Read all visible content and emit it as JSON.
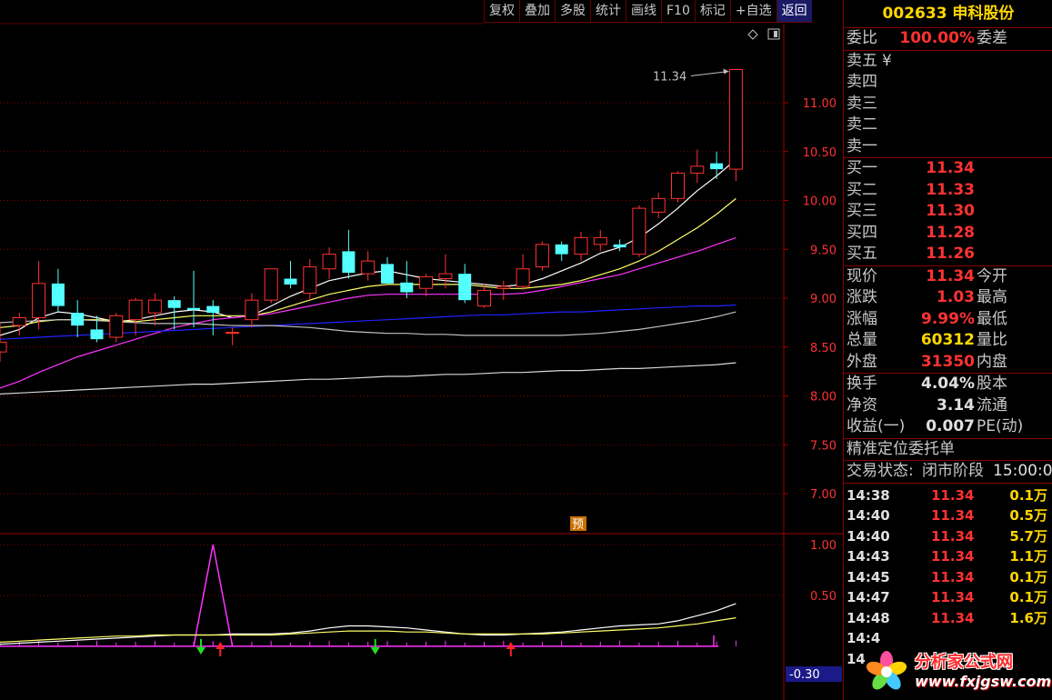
{
  "toolbar": {
    "items": [
      "复权",
      "叠加",
      "多股",
      "统计",
      "画线",
      "F10",
      "标记",
      "+自选",
      "返回"
    ]
  },
  "chart_data": {
    "type": "candlestick",
    "title": "",
    "main_axis": {
      "ylim": [
        6.6,
        11.8
      ],
      "ticks": [
        "11.00",
        "10.50",
        "10.00",
        "9.50",
        "9.00",
        "8.50",
        "8.00",
        "7.50",
        "7.00"
      ]
    },
    "high_annotation": "11.34",
    "candles": [
      {
        "o": 8.45,
        "h": 8.75,
        "l": 8.35,
        "c": 8.55
      },
      {
        "o": 8.72,
        "h": 8.85,
        "l": 8.62,
        "c": 8.8
      },
      {
        "o": 8.8,
        "h": 9.38,
        "l": 8.68,
        "c": 9.15
      },
      {
        "o": 9.15,
        "h": 9.3,
        "l": 8.85,
        "c": 8.92
      },
      {
        "o": 8.85,
        "h": 8.98,
        "l": 8.6,
        "c": 8.72
      },
      {
        "o": 8.68,
        "h": 8.82,
        "l": 8.55,
        "c": 8.58
      },
      {
        "o": 8.6,
        "h": 8.85,
        "l": 8.55,
        "c": 8.82
      },
      {
        "o": 8.78,
        "h": 9.0,
        "l": 8.62,
        "c": 8.98
      },
      {
        "o": 8.85,
        "h": 9.05,
        "l": 8.72,
        "c": 8.98
      },
      {
        "o": 8.98,
        "h": 9.02,
        "l": 8.68,
        "c": 8.9
      },
      {
        "o": 8.9,
        "h": 9.28,
        "l": 8.7,
        "c": 8.88
      },
      {
        "o": 8.92,
        "h": 8.98,
        "l": 8.62,
        "c": 8.85
      },
      {
        "o": 8.65,
        "h": 8.7,
        "l": 8.52,
        "c": 8.65
      },
      {
        "o": 8.78,
        "h": 9.05,
        "l": 8.7,
        "c": 8.98
      },
      {
        "o": 8.98,
        "h": 9.2,
        "l": 8.95,
        "c": 9.3
      },
      {
        "o": 9.2,
        "h": 9.38,
        "l": 9.1,
        "c": 9.14
      },
      {
        "o": 9.05,
        "h": 9.4,
        "l": 8.98,
        "c": 9.32
      },
      {
        "o": 9.3,
        "h": 9.52,
        "l": 9.2,
        "c": 9.45
      },
      {
        "o": 9.48,
        "h": 9.7,
        "l": 9.2,
        "c": 9.26
      },
      {
        "o": 9.25,
        "h": 9.48,
        "l": 9.18,
        "c": 9.38
      },
      {
        "o": 9.35,
        "h": 9.42,
        "l": 9.15,
        "c": 9.15
      },
      {
        "o": 9.16,
        "h": 9.38,
        "l": 9.0,
        "c": 9.06
      },
      {
        "o": 9.1,
        "h": 9.25,
        "l": 9.02,
        "c": 9.22
      },
      {
        "o": 9.2,
        "h": 9.45,
        "l": 9.1,
        "c": 9.25
      },
      {
        "o": 9.25,
        "h": 9.35,
        "l": 8.95,
        "c": 8.98
      },
      {
        "o": 8.92,
        "h": 9.15,
        "l": 8.9,
        "c": 9.08
      },
      {
        "o": 9.1,
        "h": 9.18,
        "l": 8.98,
        "c": 9.12
      },
      {
        "o": 9.12,
        "h": 9.45,
        "l": 9.08,
        "c": 9.3
      },
      {
        "o": 9.32,
        "h": 9.58,
        "l": 9.28,
        "c": 9.55
      },
      {
        "o": 9.55,
        "h": 9.58,
        "l": 9.38,
        "c": 9.45
      },
      {
        "o": 9.45,
        "h": 9.68,
        "l": 9.38,
        "c": 9.62
      },
      {
        "o": 9.55,
        "h": 9.7,
        "l": 9.48,
        "c": 9.62
      },
      {
        "o": 9.55,
        "h": 9.6,
        "l": 9.48,
        "c": 9.52
      },
      {
        "o": 9.45,
        "h": 9.95,
        "l": 9.42,
        "c": 9.92
      },
      {
        "o": 9.88,
        "h": 10.08,
        "l": 9.82,
        "c": 10.02
      },
      {
        "o": 10.02,
        "h": 10.3,
        "l": 9.98,
        "c": 10.28
      },
      {
        "o": 10.28,
        "h": 10.52,
        "l": 10.18,
        "c": 10.35
      },
      {
        "o": 10.38,
        "h": 10.5,
        "l": 10.22,
        "c": 10.32
      },
      {
        "o": 10.32,
        "h": 11.34,
        "l": 10.2,
        "c": 11.34
      }
    ],
    "ma_lines": [
      {
        "color": "#ffffff",
        "values": [
          8.62,
          8.68,
          8.8,
          8.86,
          8.84,
          8.8,
          8.76,
          8.78,
          8.82,
          8.86,
          8.88,
          8.86,
          8.8,
          8.82,
          8.92,
          9.02,
          9.1,
          9.18,
          9.22,
          9.26,
          9.28,
          9.24,
          9.2,
          9.18,
          9.16,
          9.14,
          9.12,
          9.14,
          9.2,
          9.28,
          9.36,
          9.46,
          9.52,
          9.62,
          9.76,
          9.92,
          10.1,
          10.25,
          10.42
        ]
      },
      {
        "color": "#ffff66",
        "values": [
          8.7,
          8.72,
          8.76,
          8.78,
          8.78,
          8.78,
          8.77,
          8.76,
          8.78,
          8.8,
          8.82,
          8.82,
          8.82,
          8.82,
          8.86,
          8.92,
          8.98,
          9.04,
          9.08,
          9.12,
          9.14,
          9.14,
          9.14,
          9.14,
          9.14,
          9.12,
          9.1,
          9.1,
          9.12,
          9.14,
          9.18,
          9.24,
          9.3,
          9.38,
          9.48,
          9.6,
          9.72,
          9.86,
          10.02
        ]
      },
      {
        "color": "#ff33ff",
        "values": [
          8.08,
          8.15,
          8.24,
          8.32,
          8.4,
          8.46,
          8.52,
          8.58,
          8.64,
          8.7,
          8.74,
          8.78,
          8.8,
          8.82,
          8.84,
          8.88,
          8.92,
          8.96,
          9.0,
          9.03,
          9.04,
          9.04,
          9.04,
          9.04,
          9.04,
          9.04,
          9.04,
          9.05,
          9.08,
          9.12,
          9.16,
          9.2,
          9.24,
          9.3,
          9.36,
          9.42,
          9.48,
          9.55,
          9.62
        ]
      },
      {
        "color": "#2222ff",
        "values": [
          8.58,
          8.59,
          8.6,
          8.61,
          8.62,
          8.63,
          8.64,
          8.65,
          8.66,
          8.67,
          8.68,
          8.69,
          8.7,
          8.71,
          8.72,
          8.73,
          8.74,
          8.75,
          8.76,
          8.77,
          8.78,
          8.79,
          8.8,
          8.81,
          8.82,
          8.83,
          8.83,
          8.84,
          8.85,
          8.86,
          8.86,
          8.87,
          8.88,
          8.89,
          8.9,
          8.91,
          8.92,
          8.92,
          8.93
        ]
      },
      {
        "color": "#c0c0c0",
        "values": [
          8.75,
          8.76,
          8.77,
          8.78,
          8.78,
          8.77,
          8.76,
          8.75,
          8.74,
          8.74,
          8.74,
          8.73,
          8.72,
          8.72,
          8.72,
          8.71,
          8.7,
          8.68,
          8.66,
          8.65,
          8.64,
          8.64,
          8.63,
          8.63,
          8.62,
          8.62,
          8.62,
          8.62,
          8.62,
          8.62,
          8.63,
          8.64,
          8.66,
          8.68,
          8.71,
          8.74,
          8.77,
          8.81,
          8.86
        ]
      },
      {
        "color": "#d8d8d8",
        "values": [
          8.02,
          8.03,
          8.04,
          8.05,
          8.06,
          8.07,
          8.08,
          8.09,
          8.1,
          8.11,
          8.12,
          8.12,
          8.13,
          8.14,
          8.15,
          8.16,
          8.17,
          8.17,
          8.18,
          8.19,
          8.2,
          8.2,
          8.21,
          8.22,
          8.22,
          8.23,
          8.24,
          8.24,
          8.25,
          8.26,
          8.26,
          8.27,
          8.28,
          8.28,
          8.29,
          8.3,
          8.31,
          8.32,
          8.34
        ]
      }
    ],
    "badge": "预",
    "sub_axis": {
      "ylim": [
        -0.1,
        1.1
      ],
      "ticks": [
        "1.00",
        "0.50"
      ],
      "current": "-0.30"
    },
    "sub_white": [
      0.02,
      0.03,
      0.04,
      0.05,
      0.06,
      0.07,
      0.08,
      0.09,
      0.1,
      0.11,
      0.11,
      0.11,
      0.12,
      0.12,
      0.12,
      0.13,
      0.15,
      0.18,
      0.2,
      0.2,
      0.19,
      0.18,
      0.16,
      0.14,
      0.12,
      0.11,
      0.11,
      0.12,
      0.13,
      0.14,
      0.16,
      0.18,
      0.2,
      0.21,
      0.22,
      0.25,
      0.3,
      0.35,
      0.42
    ],
    "sub_yellow": [
      0.04,
      0.05,
      0.06,
      0.07,
      0.08,
      0.09,
      0.1,
      0.1,
      0.11,
      0.11,
      0.11,
      0.11,
      0.11,
      0.11,
      0.11,
      0.12,
      0.13,
      0.14,
      0.15,
      0.15,
      0.15,
      0.14,
      0.14,
      0.13,
      0.12,
      0.12,
      0.12,
      0.12,
      0.12,
      0.13,
      0.14,
      0.15,
      0.16,
      0.17,
      0.18,
      0.2,
      0.22,
      0.25,
      0.28
    ],
    "sub_spike_index": 11,
    "down_arrows": [
      10,
      19
    ],
    "up_arrows": [
      11,
      26
    ]
  },
  "panel": {
    "header": "002633 申科股份",
    "webi": {
      "label": "委比",
      "value": "100.00%",
      "label2": "委差"
    },
    "asks": [
      "卖五",
      "卖四",
      "卖三",
      "卖二",
      "卖一"
    ],
    "ask_tail": "¥",
    "bids": [
      {
        "label": "买一",
        "value": "11.34"
      },
      {
        "label": "买二",
        "value": "11.33"
      },
      {
        "label": "买三",
        "value": "11.30"
      },
      {
        "label": "买四",
        "value": "11.28"
      },
      {
        "label": "买五",
        "value": "11.26"
      }
    ],
    "quote": [
      {
        "label": "现价",
        "value": "11.34",
        "cls": "red",
        "label2": "今开"
      },
      {
        "label": "涨跌",
        "value": "1.03",
        "cls": "red",
        "label2": "最高"
      },
      {
        "label": "涨幅",
        "value": "9.99%",
        "cls": "red",
        "label2": "最低"
      },
      {
        "label": "总量",
        "value": "60312",
        "cls": "yel",
        "label2": "量比"
      },
      {
        "label": "外盘",
        "value": "31350",
        "cls": "red",
        "label2": "内盘"
      }
    ],
    "fund": [
      {
        "label": "换手",
        "value": "4.04%",
        "label2": "股本"
      },
      {
        "label": "净资",
        "value": "3.14",
        "label2": "流通"
      },
      {
        "label": "收益(一)",
        "value": "0.007",
        "label2": "PE(动)"
      }
    ],
    "precise": "精准定位委托单",
    "status_label": "交易状态:",
    "status_value": "闭市阶段",
    "status_time": "15:00:0",
    "trades": [
      {
        "t": "14:38",
        "p": "11.34",
        "v": "0.1万"
      },
      {
        "t": "14:40",
        "p": "11.34",
        "v": "0.5万"
      },
      {
        "t": "14:40",
        "p": "11.34",
        "v": "5.7万"
      },
      {
        "t": "14:43",
        "p": "11.34",
        "v": "1.1万"
      },
      {
        "t": "14:45",
        "p": "11.34",
        "v": "0.1万"
      },
      {
        "t": "14:47",
        "p": "11.34",
        "v": "0.1万"
      },
      {
        "t": "14:48",
        "p": "11.34",
        "v": "1.6万"
      },
      {
        "t": "14:4",
        "p": "",
        "v": ""
      },
      {
        "t": "14",
        "p": "",
        "v": ""
      }
    ]
  },
  "watermark": {
    "line1": "分析家公式网",
    "line2": "www.fxjgsw.com"
  }
}
